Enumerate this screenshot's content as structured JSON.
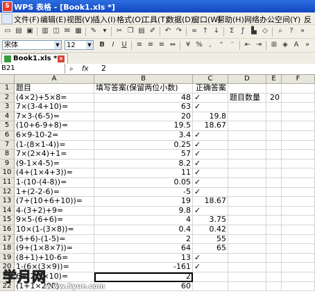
{
  "window": {
    "title": "WPS 表格 - [Book1.xls *]",
    "app_icon_glyph": "S"
  },
  "menu": [
    "文件(F)",
    "编辑(E)",
    "视图(V)",
    "插入(I)",
    "格式(O)",
    "工具(T)",
    "数据(D)",
    "窗口(W)",
    "帮助(H)",
    "网络办公空间(Y)",
    "反"
  ],
  "format": {
    "font_name": "宋体",
    "font_size": "12"
  },
  "tab": {
    "label": "Book1.xls *",
    "close_glyph": "×"
  },
  "formula_bar": {
    "cell_ref": "B21",
    "fx_glyph": "fx",
    "value": "2"
  },
  "columns": [
    "A",
    "B",
    "C",
    "D",
    "E",
    "F"
  ],
  "rows": [
    {
      "n": "1",
      "a": "题目",
      "b": "填写答案(保留两位小数)",
      "c": "正确答案",
      "d": "",
      "e": "",
      "b_num": false
    },
    {
      "n": "2",
      "a": "(4×2)+5×8=",
      "b": "48",
      "c": "✓",
      "d": "题目数量",
      "e": "20",
      "b_num": true
    },
    {
      "n": "3",
      "a": "7×(3-4+10)=",
      "b": "63",
      "c": "✓",
      "d": "",
      "e": "",
      "b_num": true
    },
    {
      "n": "4",
      "a": "7×3-(6-5)=",
      "b": "20",
      "c": "19.8",
      "d": "",
      "e": "",
      "b_num": true
    },
    {
      "n": "5",
      "a": "(10+6-9+8)=",
      "b": "19.5",
      "c": "18.67",
      "d": "",
      "e": "",
      "b_num": true
    },
    {
      "n": "6",
      "a": "6×9-10-2=",
      "b": "3.4",
      "c": "✓",
      "d": "",
      "e": "",
      "b_num": true
    },
    {
      "n": "7",
      "a": "(1-(8×1-4))=",
      "b": "0.25",
      "c": "✓",
      "d": "",
      "e": "",
      "b_num": true
    },
    {
      "n": "8",
      "a": "7×(2×4)+1=",
      "b": "57",
      "c": "✓",
      "d": "",
      "e": "",
      "b_num": true
    },
    {
      "n": "9",
      "a": "(9-1×4-5)=",
      "b": "8.2",
      "c": "✓",
      "d": "",
      "e": "",
      "b_num": true
    },
    {
      "n": "10",
      "a": "(4+(1×4+3))=",
      "b": "11",
      "c": "✓",
      "d": "",
      "e": "",
      "b_num": true
    },
    {
      "n": "11",
      "a": "1-(10-(4-8))=",
      "b": "0.05",
      "c": "✓",
      "d": "",
      "e": "",
      "b_num": true
    },
    {
      "n": "12",
      "a": "1+(2-2-6)=",
      "b": "-5",
      "c": "✓",
      "d": "",
      "e": "",
      "b_num": true
    },
    {
      "n": "13",
      "a": "(7+(10+6+10))=",
      "b": "19",
      "c": "18.67",
      "d": "",
      "e": "",
      "b_num": true
    },
    {
      "n": "14",
      "a": "4-(3+2)+9=",
      "b": "9.8",
      "c": "✓",
      "d": "",
      "e": "",
      "b_num": true
    },
    {
      "n": "15",
      "a": "9×5-(6+6)=",
      "b": "4",
      "c": "3.75",
      "d": "",
      "e": "",
      "b_num": true
    },
    {
      "n": "16",
      "a": "10×(1-(3×8))=",
      "b": "0.4",
      "c": "0.42",
      "d": "",
      "e": "",
      "b_num": true
    },
    {
      "n": "17",
      "a": "(5+6)-(1-5)=",
      "b": "2",
      "c": "55",
      "d": "",
      "e": "",
      "b_num": true
    },
    {
      "n": "18",
      "a": "(9+(1×8×7))=",
      "b": "64",
      "c": "65",
      "d": "",
      "e": "",
      "b_num": true
    },
    {
      "n": "19",
      "a": "(8+1)+10-6=",
      "b": "13",
      "c": "✓",
      "d": "",
      "e": "",
      "b_num": true
    },
    {
      "n": "20",
      "a": "1-(6×(3×9))=",
      "b": "-161",
      "c": "✓",
      "d": "",
      "e": "",
      "b_num": true
    },
    {
      "n": "21",
      "a": "6+(2-7×10)=",
      "b": "2",
      "c": "",
      "d": "",
      "e": "",
      "b_num": true
    },
    {
      "n": "22",
      "a": "(1+1×200)",
      "b": "60",
      "c": "",
      "d": "",
      "e": "",
      "b_num": true
    }
  ],
  "watermark": {
    "main": "学月网",
    "sub": "www.5yue.com"
  }
}
